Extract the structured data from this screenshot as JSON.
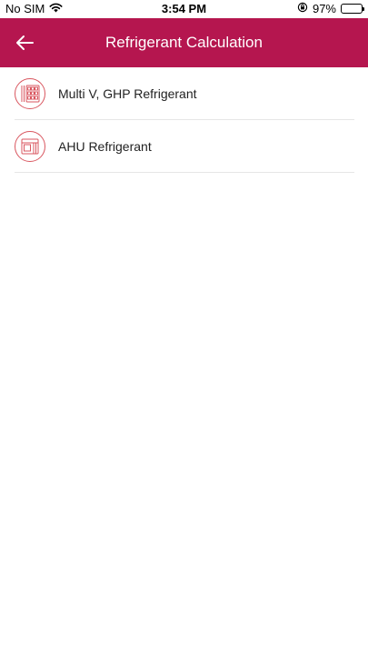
{
  "status_bar": {
    "carrier": "No SIM",
    "time": "3:54 PM",
    "battery_percent": "97%",
    "battery_level": 0.97
  },
  "nav": {
    "title": "Refrigerant Calculation",
    "color": "#b5164f"
  },
  "menu": {
    "accent_color": "#d9565f",
    "items": [
      {
        "label": "Multi V, GHP Refrigerant",
        "icon": "multi-v-unit-icon"
      },
      {
        "label": "AHU Refrigerant",
        "icon": "ahu-unit-icon"
      }
    ]
  }
}
